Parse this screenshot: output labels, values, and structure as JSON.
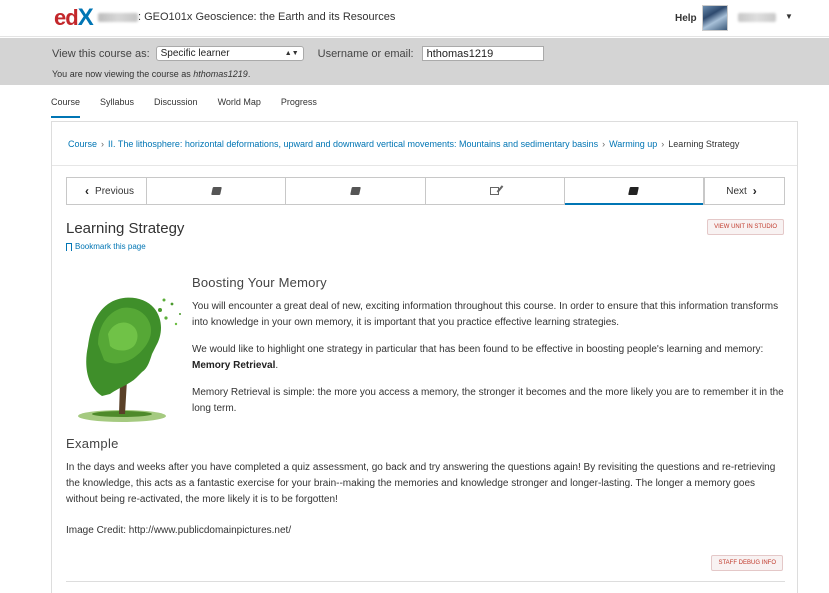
{
  "header": {
    "logo_ed": "ed",
    "logo_x": "X",
    "course_title": ": GEO101x Geoscience: the Earth and its Resources",
    "help": "Help"
  },
  "staff_bar": {
    "view_as_label": "View this course as:",
    "view_as_value": "Specific learner",
    "username_label": "Username or email:",
    "username_value": "hthomas1219",
    "viewing_prefix": "You are now viewing the course as ",
    "viewing_user": "hthomas1219",
    "viewing_suffix": "."
  },
  "tabs": [
    {
      "label": "Course",
      "active": true
    },
    {
      "label": "Syllabus"
    },
    {
      "label": "Discussion"
    },
    {
      "label": "World Map"
    },
    {
      "label": "Progress"
    }
  ],
  "breadcrumb": {
    "root": "Course",
    "section": "II. The lithosphere: horizontal deformations, upward and downward vertical movements: Mountains and sedimentary basins",
    "subsection": "Warming up",
    "current": "Learning Strategy",
    "separator": "›"
  },
  "sequence_nav": {
    "previous": "Previous",
    "next": "Next",
    "items": [
      {
        "icon": "book-icon"
      },
      {
        "icon": "book-icon"
      },
      {
        "icon": "edit-icon"
      },
      {
        "icon": "book-icon",
        "active": true
      }
    ]
  },
  "unit": {
    "title": "Learning Strategy",
    "bookmark": "Bookmark this page",
    "view_in_studio": "VIEW UNIT IN STUDIO",
    "staff_debug": "STAFF DEBUG INFO"
  },
  "article": {
    "heading": "Boosting Your Memory",
    "p1": "You will encounter a great deal of new, exciting information throughout this course. In order to ensure that this information transforms into knowledge in your own memory, it is important that you practice effective learning strategies.",
    "p2_prefix": "We would like to highlight one strategy in particular that has been found to be effective in boosting people's learning and memory: ",
    "p2_bold": "Memory Retrieval",
    "p2_suffix": ".",
    "p3": "Memory Retrieval is simple: the more you access a memory, the stronger it becomes and the more likely you are to remember it in the long term.",
    "example_heading": "Example",
    "example_text": "In the days and weeks after you have completed a quiz assessment, go back and try answering the questions again! By revisiting the questions and re-retrieving the knowledge, this acts as a fantastic exercise for your brain--making the memories and knowledge stronger and longer-lasting. The longer a memory goes without being re-activated, the more likely it is to be forgotten!",
    "credit": "Image Credit: http://www.publicdomainpictures.net/"
  },
  "colors": {
    "accent": "#0075b4",
    "brand_red": "#c3272b",
    "staff_bar": "#d4d4d4"
  }
}
